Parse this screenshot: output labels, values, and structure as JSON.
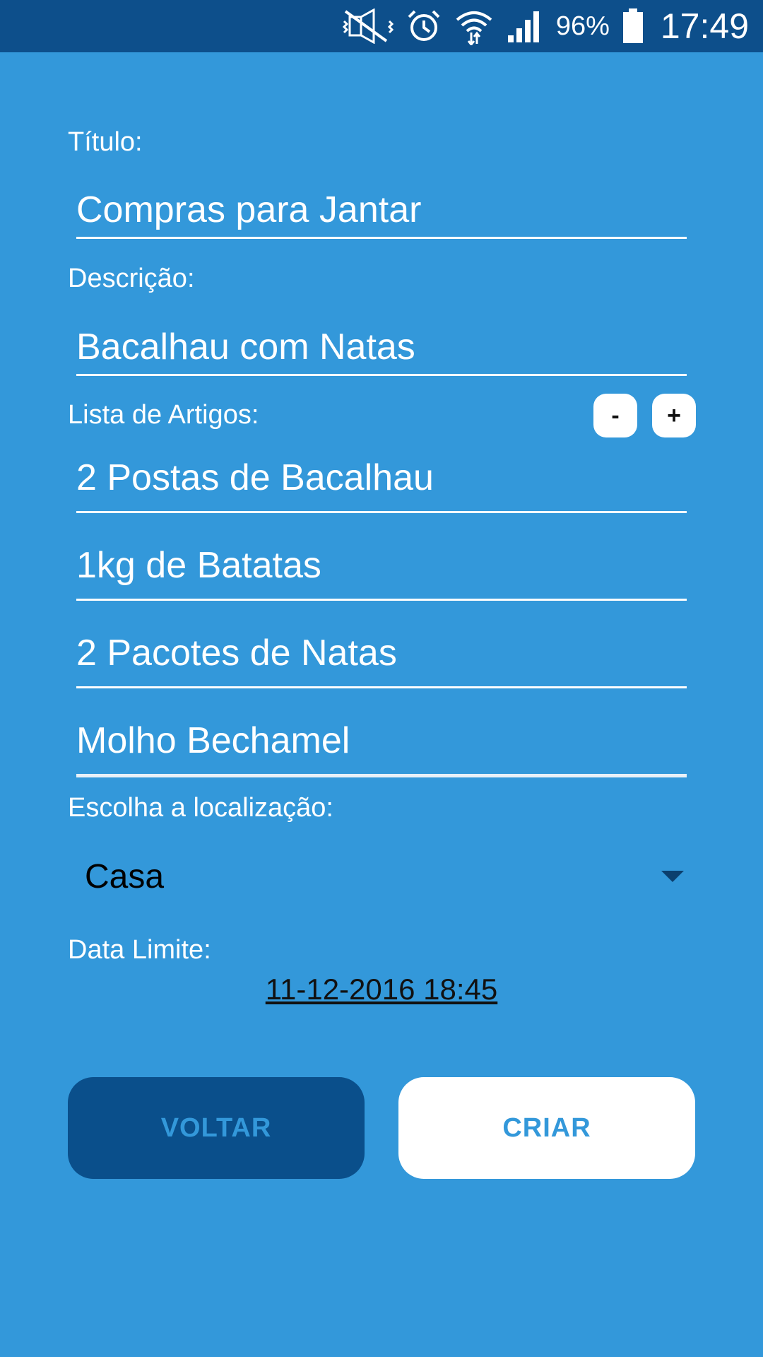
{
  "status_bar": {
    "battery": "96%",
    "time": "17:49"
  },
  "form": {
    "title_label": "Título:",
    "title_value": "Compras para Jantar",
    "description_label": "Descrição:",
    "description_value": "Bacalhau com Natas",
    "items_label": "Lista de Artigos:",
    "remove_item_label": "-",
    "add_item_label": "+",
    "items": [
      "2 Postas de Bacalhau",
      "1kg de Batatas",
      "2 Pacotes de Natas",
      "Molho Bechamel"
    ],
    "location_label": "Escolha a localização:",
    "location_value": "Casa",
    "deadline_label": "Data Limite:",
    "deadline_value": "11-12-2016 18:45"
  },
  "actions": {
    "back_label": "VOLTAR",
    "create_label": "CRIAR"
  }
}
